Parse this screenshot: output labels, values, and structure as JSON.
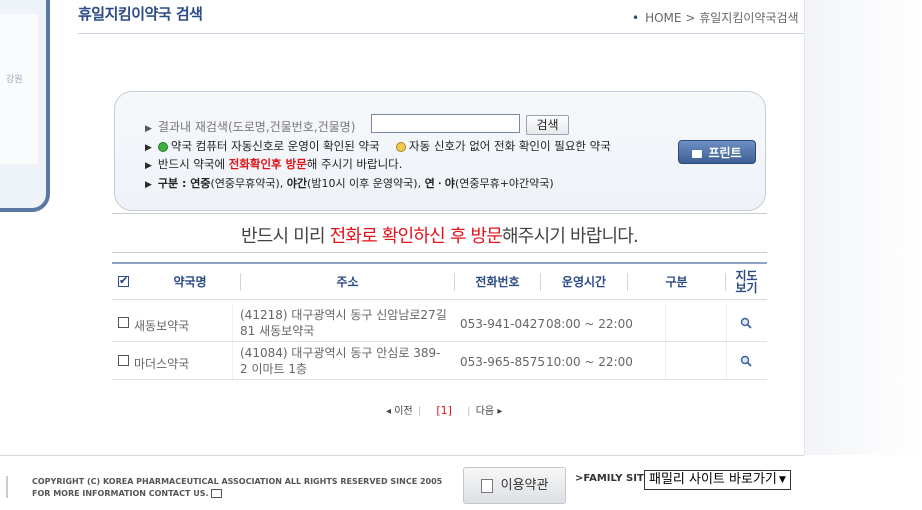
{
  "map": {
    "region_label": "강원"
  },
  "header": {
    "title": "휴일지킴이약국 검색",
    "breadcrumb": {
      "home": "HOME",
      "separator": ">",
      "current": "휴일지킴이약국검색"
    }
  },
  "search_panel": {
    "research_label": "결과내 재검색(도로명,건물번호,건물명)",
    "search_value": "",
    "search_button": "검색",
    "legend_auto": "약국 컴퓨터 자동신호로 운영이 확인된 약국",
    "legend_manual": "자동 신호가 없어 전화 확인이 필요한 약국",
    "notice_prefix": "반드시 약국에 ",
    "notice_emphasis": "전화확인후 방문",
    "notice_suffix": "해 주시기 바랍니다.",
    "category_label": "구분 : ",
    "category_a": "연중",
    "category_a_desc": "(연중무휴약국), ",
    "category_b": "야간",
    "category_b_desc": "(밤10시 이후 운영약국), ",
    "category_c": "연ㆍ야",
    "category_c_desc": "(연중무휴+야간약국)",
    "print_button": "프린트"
  },
  "notice": {
    "prefix": "반드시 미리 ",
    "emphasis": "전화로 확인하신 후 방문",
    "suffix": "해주시기 바랍니다."
  },
  "table": {
    "headers": {
      "name": "약국명",
      "address": "주소",
      "phone": "전화번호",
      "hours": "운영시간",
      "category": "구분",
      "map_line1": "지도",
      "map_line2": "보기"
    },
    "rows": [
      {
        "name": "새동보약국",
        "address_line1": "(41218) 대구광역시 동구 신암남로27길",
        "address_line2": "81 새동보약국",
        "phone": "053-941-0427",
        "hours": "08:00 ~ 22:00",
        "category": ""
      },
      {
        "name": "마더스약국",
        "address_line1": "(41084) 대구광역시 동구 안심로 389-",
        "address_line2": "2 이마트 1층",
        "phone": "053-965-8575",
        "hours": "10:00 ~ 22:00",
        "category": ""
      }
    ]
  },
  "pager": {
    "prev": "이전",
    "current": "[1]",
    "next": "다음"
  },
  "footer": {
    "copyright_line1": "COPYRIGHT (C) KOREA PHARMACEUTICAL ASSOCIATION ALL RIGHTS RESERVED SINCE 2005",
    "copyright_line2": "FOR MORE INFORMATION CONTACT US.",
    "terms_button": "이용약관",
    "family_label": "FAMILY SITE",
    "family_select": "패밀리 사이트 바로가기"
  }
}
